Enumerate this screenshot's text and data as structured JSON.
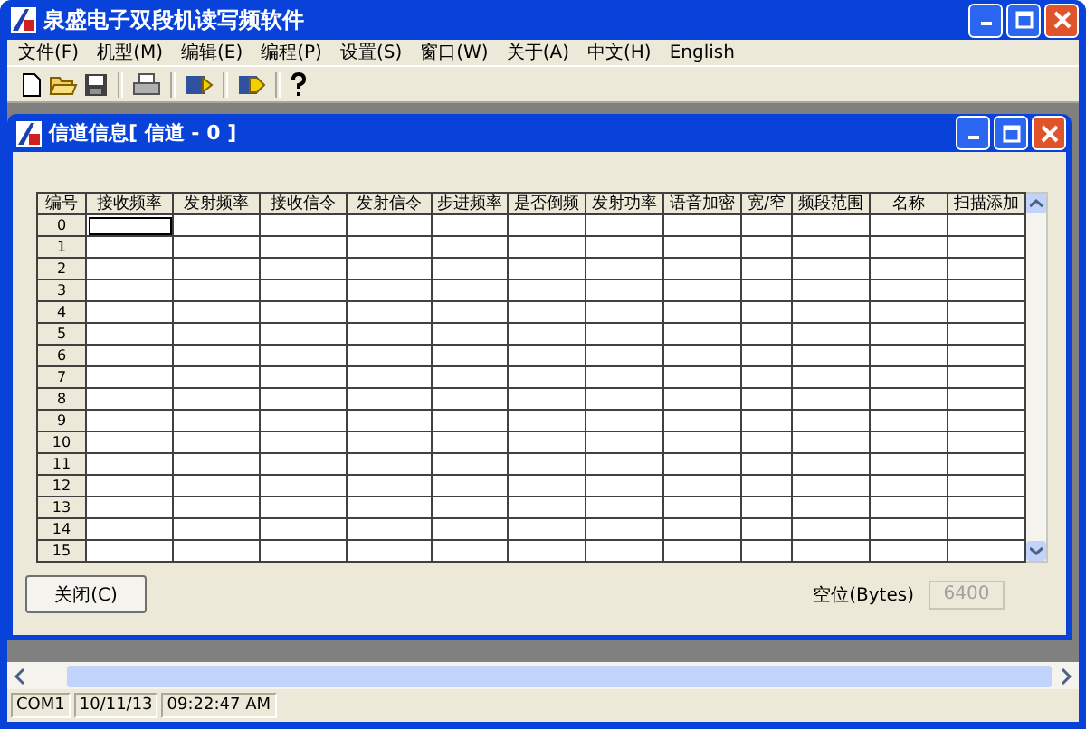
{
  "window": {
    "title": "泉盛电子双段机读写频软件"
  },
  "menu": [
    "文件(F)",
    "机型(M)",
    "编辑(E)",
    "编程(P)",
    "设置(S)",
    "窗口(W)",
    "关于(A)",
    "中文(H)",
    "English"
  ],
  "child_window": {
    "title": "信道信息[ 信道 - 0 ]",
    "table": {
      "columns": [
        "编号",
        "接收频率",
        "发射频率",
        "接收信令",
        "发射信令",
        "步进频率",
        "是否倒频",
        "发射功率",
        "语音加密",
        "宽/窄",
        "频段范围",
        "名称",
        "扫描添加"
      ],
      "rows": [
        "0",
        "1",
        "2",
        "3",
        "4",
        "5",
        "6",
        "7",
        "8",
        "9",
        "10",
        "11",
        "12",
        "13",
        "14",
        "15"
      ]
    },
    "close_button": "关闭(C)",
    "free_space": {
      "label": "空位(Bytes)",
      "value": "6400"
    }
  },
  "status_bar": [
    "COM1",
    "10/11/13",
    "09:22:47 AM"
  ]
}
